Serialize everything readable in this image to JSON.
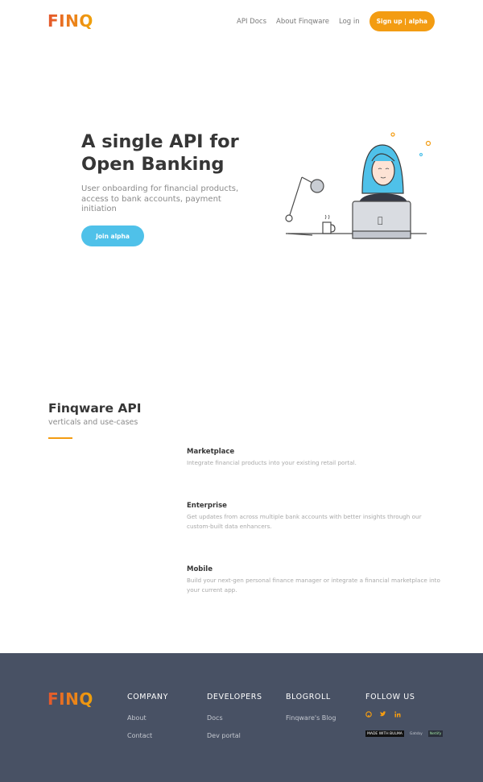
{
  "brand": {
    "logo_text": "FINQ",
    "accent": "#f39c12",
    "brand_gradient": [
      "#e4572e",
      "#f0a30a"
    ],
    "cta_color": "#4fc1e9",
    "footer_bg": "#485164"
  },
  "nav": {
    "links": [
      "API Docs",
      "About Finqware",
      "Log in"
    ],
    "signup_label": "Sign up | alpha"
  },
  "hero": {
    "title": "A single API for Open Banking",
    "subtitle": "User onboarding for financial products, access to bank accounts, payment initiation",
    "cta_label": "Join alpha",
    "illustration": "woman-with-laptop-at-desk-illustration"
  },
  "api": {
    "title": "Finqware API",
    "subtitle": "verticals and use-cases",
    "features": [
      {
        "title": "Marketplace",
        "desc": "Integrate financial products into your existing retail portal."
      },
      {
        "title": "Enterprise",
        "desc": "Get updates from across multiple bank accounts with better insights through our custom-built data enhancers."
      },
      {
        "title": "Mobile",
        "desc": "Build your next-gen personal finance manager or integrate a financial marketplace into your current app."
      }
    ]
  },
  "footer": {
    "logo_text": "FINQ",
    "columns": [
      {
        "heading": "COMPANY",
        "links": [
          "About",
          "Contact"
        ]
      },
      {
        "heading": "DEVELOPERS",
        "links": [
          "Docs",
          "Dev portal"
        ]
      },
      {
        "heading": "BLOGROLL",
        "links": [
          "Finqware's Blog"
        ]
      },
      {
        "heading": "FOLLOW US",
        "links": []
      }
    ],
    "social_icons": [
      "github-icon",
      "twitter-icon",
      "linkedin-icon"
    ],
    "badges": [
      "MADE WITH BULMA",
      "Gatsby",
      "Netlify"
    ]
  }
}
